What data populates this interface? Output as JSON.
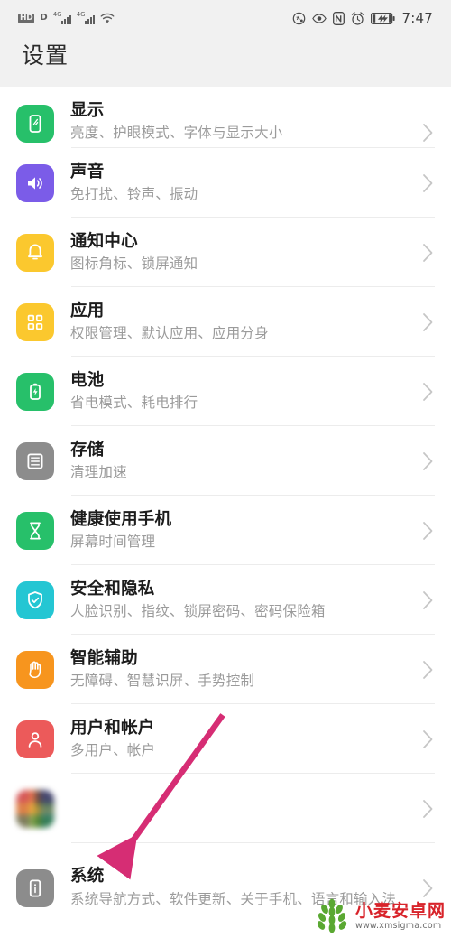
{
  "status_bar": {
    "hd_label": "HD",
    "data_letter": "D",
    "network_label_1": "4G",
    "network_label_2": "4G",
    "icons": [
      "hd-icon",
      "data-icon",
      "signal-4g-icon",
      "signal-4g-icon",
      "wifi-icon",
      "sync-circle-icon",
      "eye-comfort-icon",
      "nfc-icon",
      "alarm-clock-icon",
      "battery-charging-icon"
    ],
    "time": "7:47"
  },
  "header": {
    "title": "设置"
  },
  "settings": {
    "items": [
      {
        "title": "显示",
        "subtitle": "亮度、护眼模式、字体与显示大小",
        "icon": "display-icon",
        "color": "#27c06a"
      },
      {
        "title": "声音",
        "subtitle": "免打扰、铃声、振动",
        "icon": "sound-icon",
        "color": "#7b5ce8"
      },
      {
        "title": "通知中心",
        "subtitle": "图标角标、锁屏通知",
        "icon": "notification-bell-icon",
        "color": "#fbc82e"
      },
      {
        "title": "应用",
        "subtitle": "权限管理、默认应用、应用分身",
        "icon": "apps-grid-icon",
        "color": "#fbc82e"
      },
      {
        "title": "电池",
        "subtitle": "省电模式、耗电排行",
        "icon": "battery-icon",
        "color": "#27c06a"
      },
      {
        "title": "存储",
        "subtitle": "清理加速",
        "icon": "storage-icon",
        "color": "#8c8c8c"
      },
      {
        "title": "健康使用手机",
        "subtitle": "屏幕时间管理",
        "icon": "hourglass-icon",
        "color": "#27c06a"
      },
      {
        "title": "安全和隐私",
        "subtitle": "人脸识别、指纹、锁屏密码、密码保险箱",
        "icon": "shield-check-icon",
        "color": "#24c6d3"
      },
      {
        "title": "智能辅助",
        "subtitle": "无障碍、智慧识屏、手势控制",
        "icon": "hand-icon",
        "color": "#f7951e"
      },
      {
        "title": "用户和帐户",
        "subtitle": "多用户、帐户",
        "icon": "user-account-icon",
        "color": "#ec5a5a"
      }
    ],
    "blurred_item": {
      "title": "",
      "subtitle": "",
      "icon": "google-multicolor-icon"
    },
    "system_item": {
      "title": "系统",
      "subtitle": "系统导航方式、软件更新、关于手机、语言和输入法",
      "icon": "system-info-icon",
      "color": "#8c8c8c"
    },
    "chevron": "chevron-right-icon"
  },
  "annotation": {
    "arrow_color": "#d62d74",
    "name": "pink-arrow-pointing-to-system"
  },
  "watermark": {
    "site_name": "小麦安卓网",
    "url": "www.xmsigma.com",
    "logo": "wheat-logo"
  }
}
